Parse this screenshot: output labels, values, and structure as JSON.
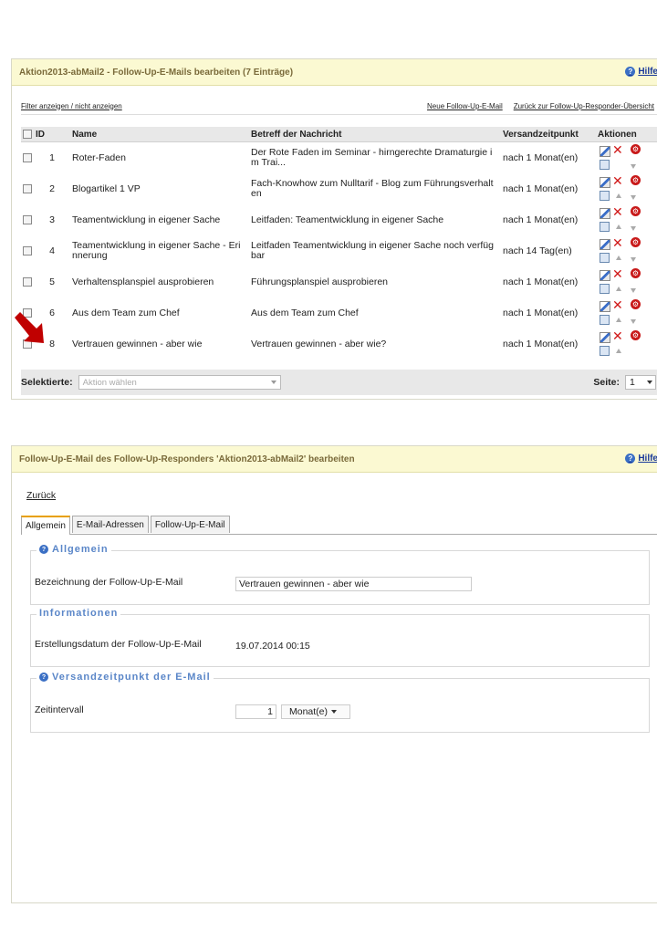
{
  "list_panel": {
    "title": "Aktion2013-abMail2 - Follow-Up-E-Mails bearbeiten (7 Einträge)",
    "help_label": "Hilfe",
    "filter_link": "Filter anzeigen / nicht anzeigen",
    "new_link": "Neue Follow-Up-E-Mail",
    "back_link": "Zurück zur Follow-Up-Responder-Übersicht",
    "columns": [
      "ID",
      "Name",
      "Betreff der Nachricht",
      "Versandzeitpunkt",
      "Aktionen"
    ],
    "rows": [
      {
        "id": "1",
        "name": "Roter-Faden",
        "subject": "Der Rote Faden im Seminar - hirngerechte Dramaturgie i m Trai...",
        "time": "nach 1 Monat(en)"
      },
      {
        "id": "2",
        "name": "Blogartikel 1 VP",
        "subject": "Fach-Knowhow zum Nulltarif - Blog zum Führungsverhalt en",
        "time": "nach 1 Monat(en)"
      },
      {
        "id": "3",
        "name": "Teamentwicklung in eigener Sache",
        "subject": "Leitfaden: Teamentwicklung in eigener Sache",
        "time": "nach 1 Monat(en)"
      },
      {
        "id": "4",
        "name": "Teamentwicklung in eigener Sache - Eri nnerung",
        "subject": "Leitfaden Teamentwicklung in eigener Sache noch verfüg bar",
        "time": "nach 14 Tag(en)"
      },
      {
        "id": "5",
        "name": "Verhaltensplanspiel ausprobieren",
        "subject": "Führungsplanspiel ausprobieren",
        "time": "nach 1 Monat(en)"
      },
      {
        "id": "6",
        "name": "Aus dem Team zum Chef",
        "subject": "Aus dem Team zum Chef",
        "time": "nach 1 Monat(en)"
      },
      {
        "id": "8",
        "name": "Vertrauen gewinnen - aber wie",
        "subject": "Vertrauen gewinnen - aber wie?",
        "time": "nach 1 Monat(en)"
      }
    ],
    "selected_label": "Selektierte:",
    "action_placeholder": "Aktion wählen",
    "page_label": "Seite:",
    "page_value": "1"
  },
  "edit_panel": {
    "title": "Follow-Up-E-Mail des Follow-Up-Responders 'Aktion2013-abMail2' bearbeiten",
    "help_label": "Hilfe",
    "back_link": "Zurück",
    "tabs": [
      "Allgemein",
      "E-Mail-Adressen",
      "Follow-Up-E-Mail"
    ],
    "section_general": "Allgemein",
    "name_label": "Bezeichnung der Follow-Up-E-Mail",
    "name_value": "Vertrauen gewinnen - aber wie",
    "section_info": "Informationen",
    "created_label": "Erstellungsdatum der Follow-Up-E-Mail",
    "created_value": "19.07.2014 00:15",
    "section_send": "Versandzeitpunkt der E-Mail",
    "interval_label": "Zeitintervall",
    "interval_value": "1",
    "interval_unit": "Monat(e)"
  },
  "colors": {
    "header_bg": "#fbf9d2",
    "arrow": "#c00000",
    "delete": "#d01818",
    "legend": "#5a86c8"
  }
}
